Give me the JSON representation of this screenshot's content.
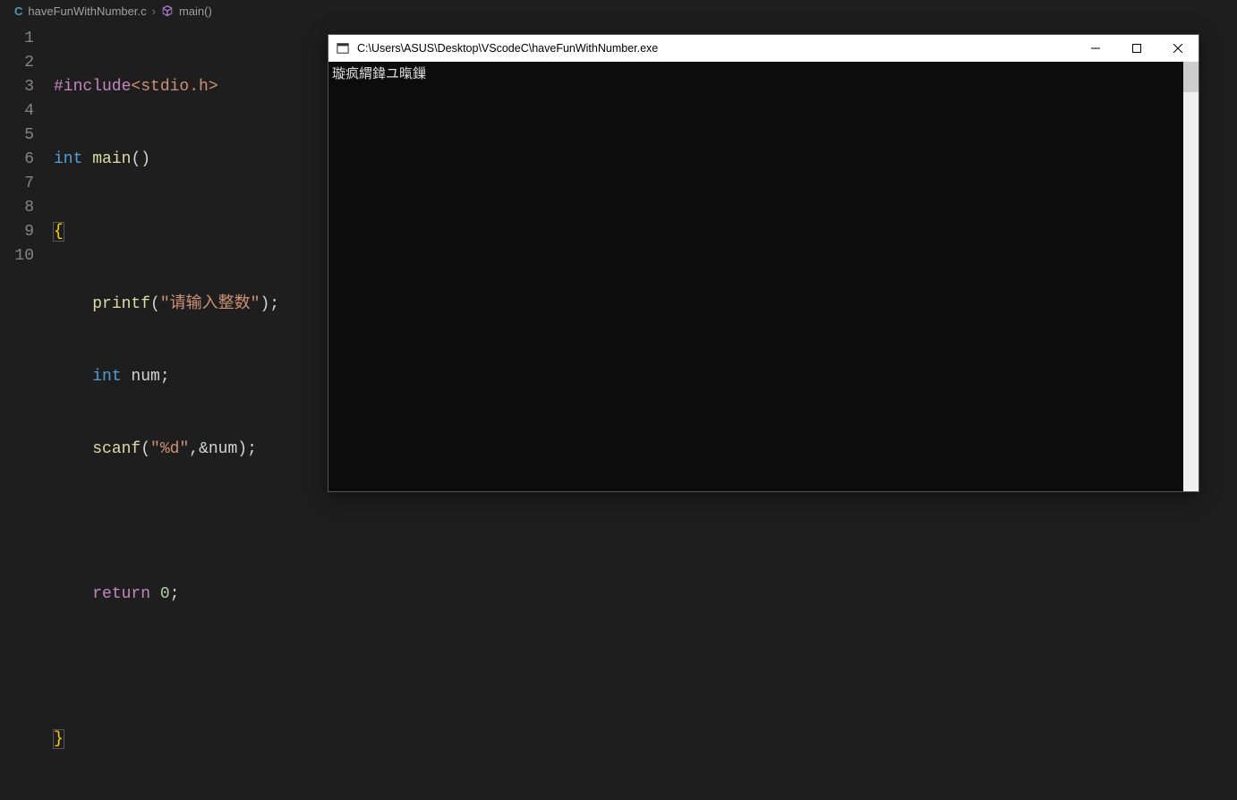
{
  "breadcrumb": {
    "file_icon": "C",
    "file_name": "haveFunWithNumber.c",
    "separator": "›",
    "symbol_name": "main()"
  },
  "code": {
    "lines": [
      1,
      2,
      3,
      4,
      5,
      6,
      7,
      8,
      9,
      10
    ],
    "l1": {
      "include": "#include",
      "header": "<stdio.h>"
    },
    "l2": {
      "type": "int",
      "func": "main",
      "paren": "()"
    },
    "l3": {
      "brace": "{"
    },
    "l4": {
      "indent": "    ",
      "func": "printf",
      "open": "(",
      "str": "\"请输入整数\"",
      "close": ")",
      "semi": ";"
    },
    "l5": {
      "indent": "    ",
      "type": "int",
      "var": " num",
      "semi": ";"
    },
    "l6": {
      "indent": "    ",
      "func": "scanf",
      "open": "(",
      "str": "\"%d\"",
      "mid": ",&num",
      "close": ")",
      "semi": ";"
    },
    "l7": {
      "blank": ""
    },
    "l8": {
      "indent": "    ",
      "ret": "return",
      "sp": " ",
      "num": "0",
      "semi": ";"
    },
    "l9": {
      "blank": ""
    },
    "l10": {
      "brace": "}"
    }
  },
  "console": {
    "title": "C:\\Users\\ASUS\\Desktop\\VScodeC\\haveFunWithNumber.exe",
    "output": "璇疯緭鍏ユ暣鏁"
  }
}
